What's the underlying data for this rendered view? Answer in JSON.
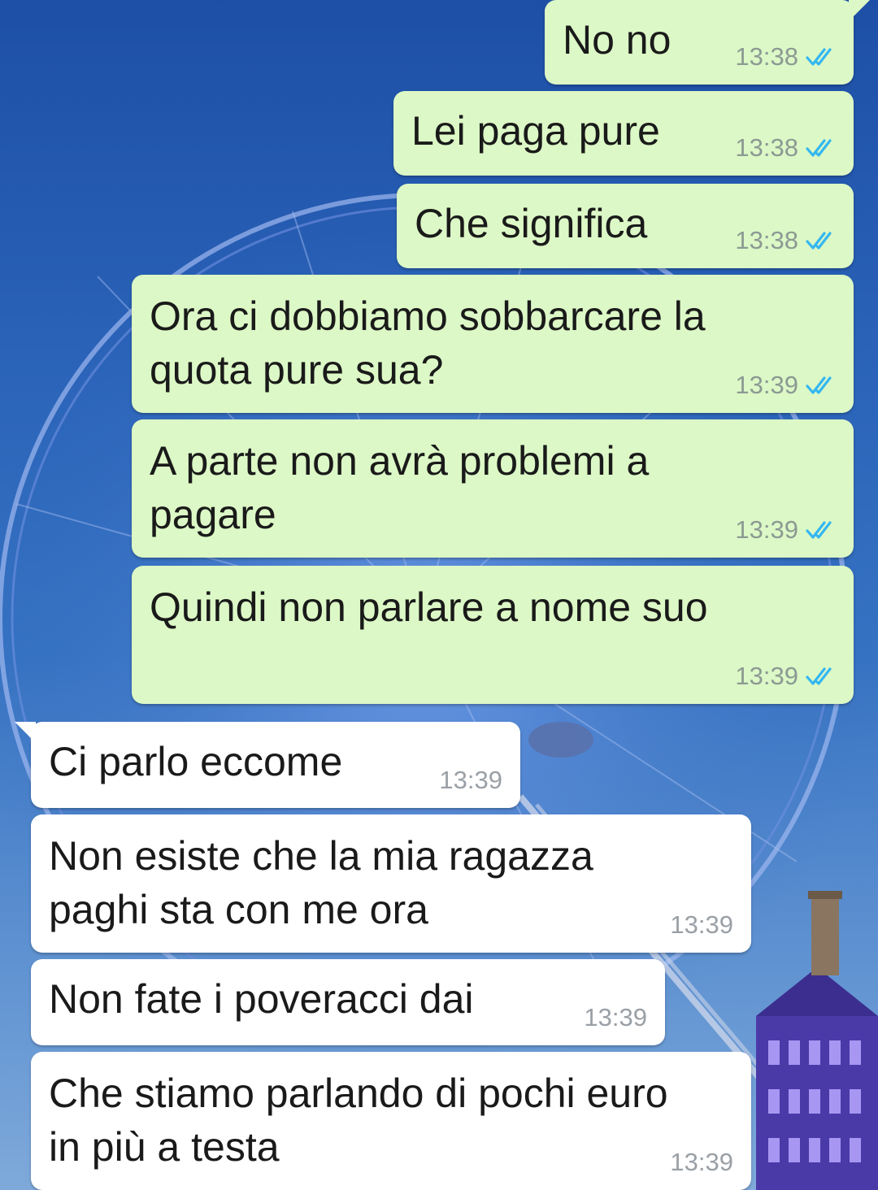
{
  "chat": {
    "messages": [
      {
        "direction": "outgoing",
        "text": "No no",
        "time": "13:38",
        "status_icon": "double-check-read-icon"
      },
      {
        "direction": "outgoing",
        "text": "Lei paga pure",
        "time": "13:38",
        "status_icon": "double-check-read-icon"
      },
      {
        "direction": "outgoing",
        "text": "Che significa",
        "time": "13:38",
        "status_icon": "double-check-read-icon"
      },
      {
        "direction": "outgoing",
        "text": "Ora ci dobbiamo sobbarcare la\nquota pure sua?",
        "time": "13:39",
        "status_icon": "double-check-read-icon"
      },
      {
        "direction": "outgoing",
        "text": "A parte non avrà problemi a\npagare",
        "time": "13:39",
        "status_icon": "double-check-read-icon"
      },
      {
        "direction": "outgoing",
        "text": "Quindi non parlare a nome suo",
        "time": "13:39",
        "status_icon": "double-check-read-icon"
      },
      {
        "direction": "incoming",
        "text": "Ci parlo eccome",
        "time": "13:39"
      },
      {
        "direction": "incoming",
        "text": "Non esiste che la mia ragazza\npaghi sta con me ora",
        "time": "13:39"
      },
      {
        "direction": "incoming",
        "text": "Non fate i poveracci dai",
        "time": "13:39"
      },
      {
        "direction": "incoming",
        "text": "Che stiamo parlando di pochi euro\nin più a testa",
        "time": "13:39"
      }
    ]
  },
  "colors": {
    "outgoing_bubble": "#dcf8c6",
    "incoming_bubble": "#ffffff",
    "read_ticks": "#34b7f1",
    "timestamp": "#8c9a93"
  }
}
